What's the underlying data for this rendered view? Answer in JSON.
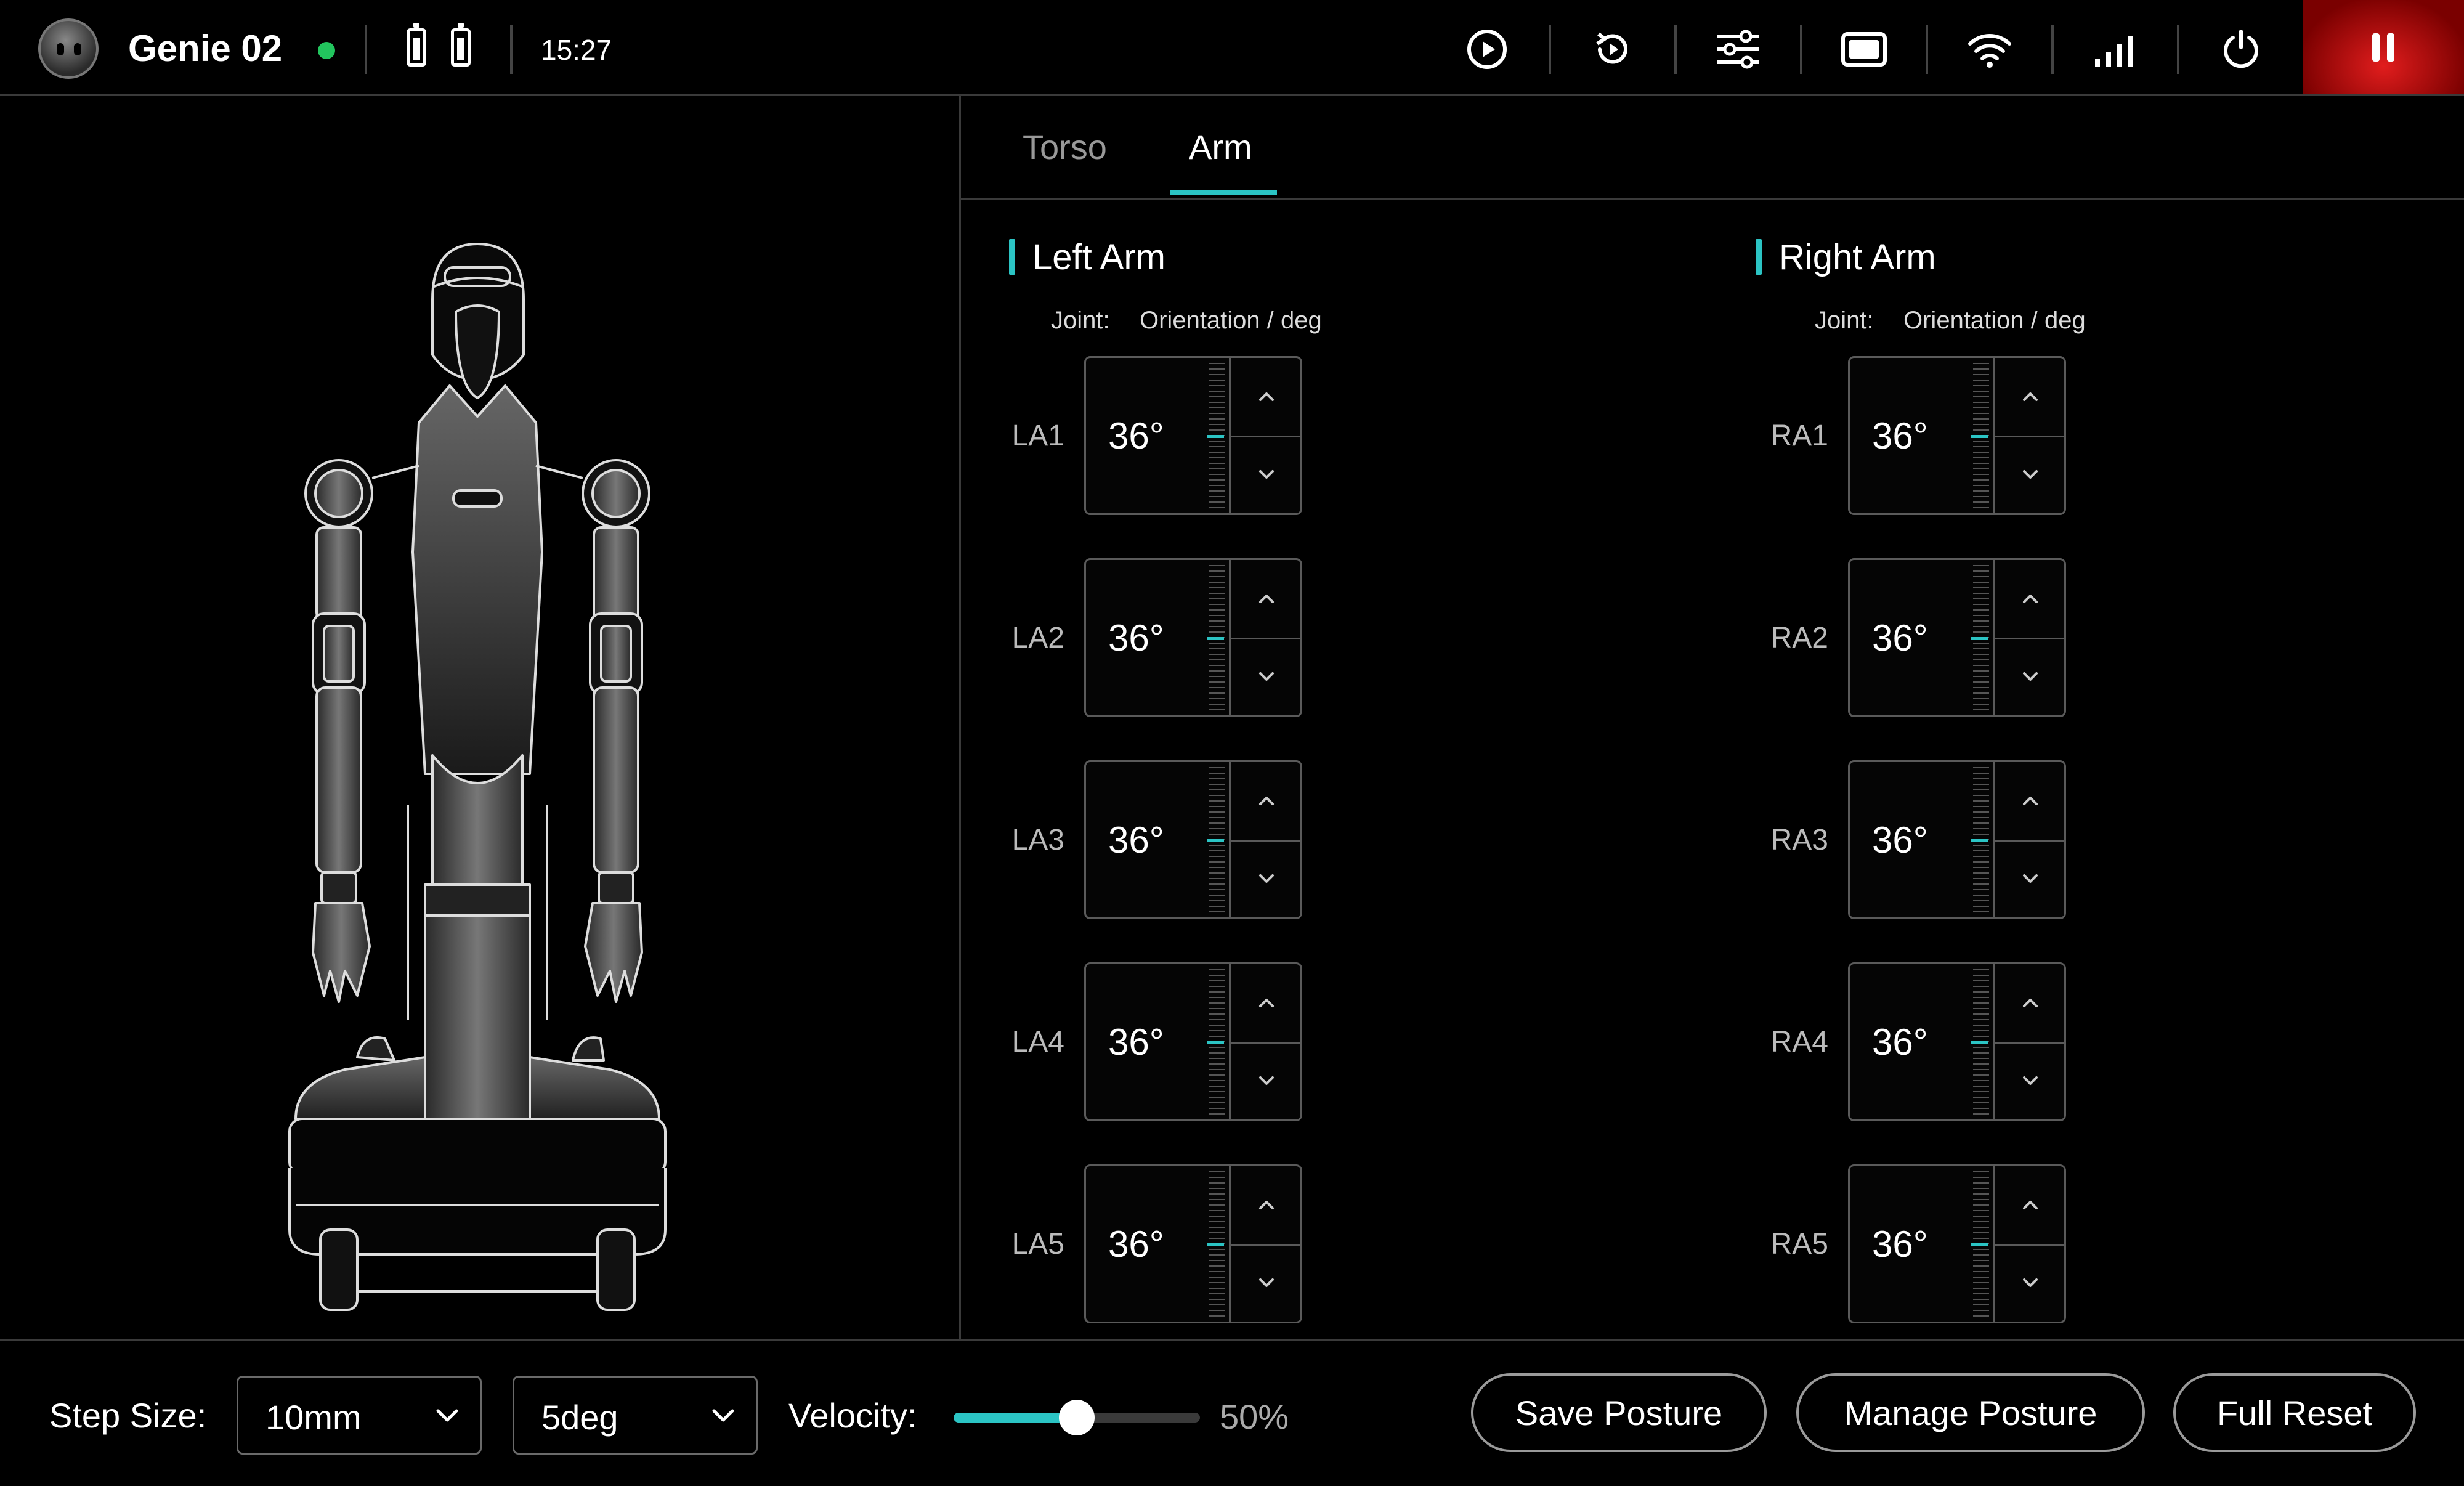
{
  "header": {
    "device_name": "Genie 02",
    "time": "15:27"
  },
  "tabs": [
    {
      "label": "Torso",
      "active": false
    },
    {
      "label": "Arm",
      "active": true
    }
  ],
  "left_arm": {
    "title": "Left Arm",
    "subtitle_joint": "Joint:",
    "subtitle_orientation": "Orientation / deg",
    "joints": [
      {
        "label": "LA1",
        "value": "36°"
      },
      {
        "label": "LA2",
        "value": "36°"
      },
      {
        "label": "LA3",
        "value": "36°"
      },
      {
        "label": "LA4",
        "value": "36°"
      },
      {
        "label": "LA5",
        "value": "36°"
      }
    ]
  },
  "right_arm": {
    "title": "Right Arm",
    "subtitle_joint": "Joint:",
    "subtitle_orientation": "Orientation / deg",
    "joints": [
      {
        "label": "RA1",
        "value": "36°"
      },
      {
        "label": "RA2",
        "value": "36°"
      },
      {
        "label": "RA3",
        "value": "36°"
      },
      {
        "label": "RA4",
        "value": "36°"
      },
      {
        "label": "RA5",
        "value": "36°"
      }
    ]
  },
  "footer": {
    "step_size_label": "Step Size:",
    "step_linear": "10mm",
    "step_angular": "5deg",
    "velocity_label": "Velocity:",
    "velocity_value": "50%",
    "velocity_fraction": 0.5,
    "save_posture": "Save Posture",
    "manage_posture": "Manage Posture",
    "full_reset": "Full Reset"
  },
  "colors": {
    "accent": "#2bc4c4",
    "status_online": "#22c55e",
    "stop": "#e11d1d"
  },
  "icons": [
    "robot-logo-icon",
    "battery-icon",
    "play-icon",
    "replay-icon",
    "sliders-icon",
    "screen-icon",
    "wifi-icon",
    "signal-icon",
    "power-icon",
    "pause-icon",
    "chevron-up-icon",
    "chevron-down-icon",
    "robot-illustration"
  ]
}
